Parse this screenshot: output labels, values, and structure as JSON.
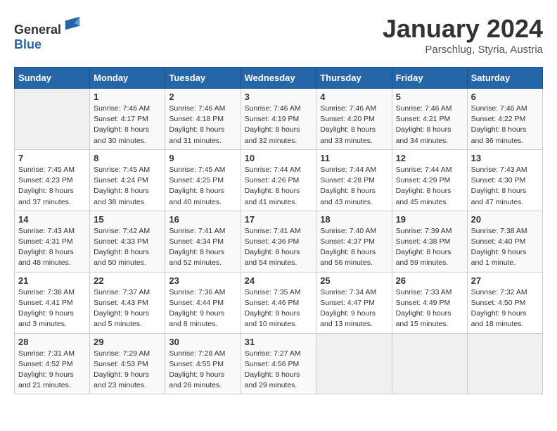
{
  "logo": {
    "text_general": "General",
    "text_blue": "Blue"
  },
  "title": "January 2024",
  "subtitle": "Parschlug, Styria, Austria",
  "days_of_week": [
    "Sunday",
    "Monday",
    "Tuesday",
    "Wednesday",
    "Thursday",
    "Friday",
    "Saturday"
  ],
  "weeks": [
    [
      {
        "day": "",
        "sunrise": "",
        "sunset": "",
        "daylight": ""
      },
      {
        "day": "1",
        "sunrise": "Sunrise: 7:46 AM",
        "sunset": "Sunset: 4:17 PM",
        "daylight": "Daylight: 8 hours and 30 minutes."
      },
      {
        "day": "2",
        "sunrise": "Sunrise: 7:46 AM",
        "sunset": "Sunset: 4:18 PM",
        "daylight": "Daylight: 8 hours and 31 minutes."
      },
      {
        "day": "3",
        "sunrise": "Sunrise: 7:46 AM",
        "sunset": "Sunset: 4:19 PM",
        "daylight": "Daylight: 8 hours and 32 minutes."
      },
      {
        "day": "4",
        "sunrise": "Sunrise: 7:46 AM",
        "sunset": "Sunset: 4:20 PM",
        "daylight": "Daylight: 8 hours and 33 minutes."
      },
      {
        "day": "5",
        "sunrise": "Sunrise: 7:46 AM",
        "sunset": "Sunset: 4:21 PM",
        "daylight": "Daylight: 8 hours and 34 minutes."
      },
      {
        "day": "6",
        "sunrise": "Sunrise: 7:46 AM",
        "sunset": "Sunset: 4:22 PM",
        "daylight": "Daylight: 8 hours and 36 minutes."
      }
    ],
    [
      {
        "day": "7",
        "sunrise": "Sunrise: 7:45 AM",
        "sunset": "Sunset: 4:23 PM",
        "daylight": "Daylight: 8 hours and 37 minutes."
      },
      {
        "day": "8",
        "sunrise": "Sunrise: 7:45 AM",
        "sunset": "Sunset: 4:24 PM",
        "daylight": "Daylight: 8 hours and 38 minutes."
      },
      {
        "day": "9",
        "sunrise": "Sunrise: 7:45 AM",
        "sunset": "Sunset: 4:25 PM",
        "daylight": "Daylight: 8 hours and 40 minutes."
      },
      {
        "day": "10",
        "sunrise": "Sunrise: 7:44 AM",
        "sunset": "Sunset: 4:26 PM",
        "daylight": "Daylight: 8 hours and 41 minutes."
      },
      {
        "day": "11",
        "sunrise": "Sunrise: 7:44 AM",
        "sunset": "Sunset: 4:28 PM",
        "daylight": "Daylight: 8 hours and 43 minutes."
      },
      {
        "day": "12",
        "sunrise": "Sunrise: 7:44 AM",
        "sunset": "Sunset: 4:29 PM",
        "daylight": "Daylight: 8 hours and 45 minutes."
      },
      {
        "day": "13",
        "sunrise": "Sunrise: 7:43 AM",
        "sunset": "Sunset: 4:30 PM",
        "daylight": "Daylight: 8 hours and 47 minutes."
      }
    ],
    [
      {
        "day": "14",
        "sunrise": "Sunrise: 7:43 AM",
        "sunset": "Sunset: 4:31 PM",
        "daylight": "Daylight: 8 hours and 48 minutes."
      },
      {
        "day": "15",
        "sunrise": "Sunrise: 7:42 AM",
        "sunset": "Sunset: 4:33 PM",
        "daylight": "Daylight: 8 hours and 50 minutes."
      },
      {
        "day": "16",
        "sunrise": "Sunrise: 7:41 AM",
        "sunset": "Sunset: 4:34 PM",
        "daylight": "Daylight: 8 hours and 52 minutes."
      },
      {
        "day": "17",
        "sunrise": "Sunrise: 7:41 AM",
        "sunset": "Sunset: 4:36 PM",
        "daylight": "Daylight: 8 hours and 54 minutes."
      },
      {
        "day": "18",
        "sunrise": "Sunrise: 7:40 AM",
        "sunset": "Sunset: 4:37 PM",
        "daylight": "Daylight: 8 hours and 56 minutes."
      },
      {
        "day": "19",
        "sunrise": "Sunrise: 7:39 AM",
        "sunset": "Sunset: 4:38 PM",
        "daylight": "Daylight: 8 hours and 59 minutes."
      },
      {
        "day": "20",
        "sunrise": "Sunrise: 7:38 AM",
        "sunset": "Sunset: 4:40 PM",
        "daylight": "Daylight: 9 hours and 1 minute."
      }
    ],
    [
      {
        "day": "21",
        "sunrise": "Sunrise: 7:38 AM",
        "sunset": "Sunset: 4:41 PM",
        "daylight": "Daylight: 9 hours and 3 minutes."
      },
      {
        "day": "22",
        "sunrise": "Sunrise: 7:37 AM",
        "sunset": "Sunset: 4:43 PM",
        "daylight": "Daylight: 9 hours and 5 minutes."
      },
      {
        "day": "23",
        "sunrise": "Sunrise: 7:36 AM",
        "sunset": "Sunset: 4:44 PM",
        "daylight": "Daylight: 9 hours and 8 minutes."
      },
      {
        "day": "24",
        "sunrise": "Sunrise: 7:35 AM",
        "sunset": "Sunset: 4:46 PM",
        "daylight": "Daylight: 9 hours and 10 minutes."
      },
      {
        "day": "25",
        "sunrise": "Sunrise: 7:34 AM",
        "sunset": "Sunset: 4:47 PM",
        "daylight": "Daylight: 9 hours and 13 minutes."
      },
      {
        "day": "26",
        "sunrise": "Sunrise: 7:33 AM",
        "sunset": "Sunset: 4:49 PM",
        "daylight": "Daylight: 9 hours and 15 minutes."
      },
      {
        "day": "27",
        "sunrise": "Sunrise: 7:32 AM",
        "sunset": "Sunset: 4:50 PM",
        "daylight": "Daylight: 9 hours and 18 minutes."
      }
    ],
    [
      {
        "day": "28",
        "sunrise": "Sunrise: 7:31 AM",
        "sunset": "Sunset: 4:52 PM",
        "daylight": "Daylight: 9 hours and 21 minutes."
      },
      {
        "day": "29",
        "sunrise": "Sunrise: 7:29 AM",
        "sunset": "Sunset: 4:53 PM",
        "daylight": "Daylight: 9 hours and 23 minutes."
      },
      {
        "day": "30",
        "sunrise": "Sunrise: 7:28 AM",
        "sunset": "Sunset: 4:55 PM",
        "daylight": "Daylight: 9 hours and 26 minutes."
      },
      {
        "day": "31",
        "sunrise": "Sunrise: 7:27 AM",
        "sunset": "Sunset: 4:56 PM",
        "daylight": "Daylight: 9 hours and 29 minutes."
      },
      {
        "day": "",
        "sunrise": "",
        "sunset": "",
        "daylight": ""
      },
      {
        "day": "",
        "sunrise": "",
        "sunset": "",
        "daylight": ""
      },
      {
        "day": "",
        "sunrise": "",
        "sunset": "",
        "daylight": ""
      }
    ]
  ]
}
